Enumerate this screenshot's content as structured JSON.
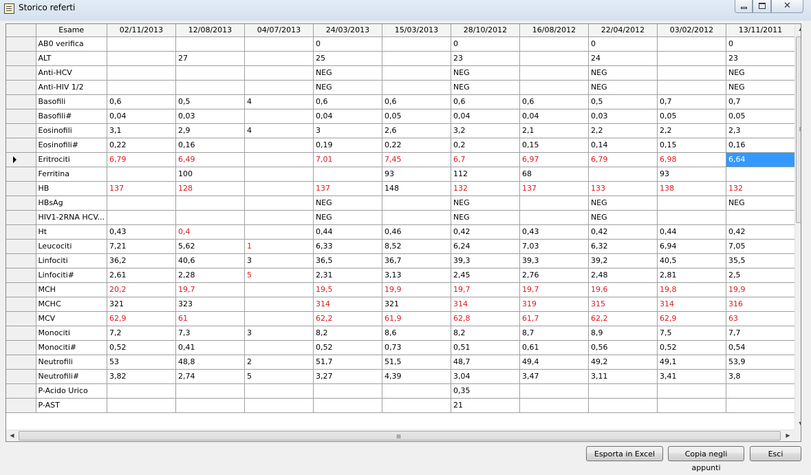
{
  "window": {
    "title": "Storico referti"
  },
  "grid": {
    "columns": [
      "Esame",
      "02/11/2013",
      "12/08/2013",
      "04/07/2013",
      "24/03/2013",
      "15/03/2013",
      "28/10/2012",
      "16/08/2012",
      "22/04/2012",
      "03/02/2012",
      "13/11/2011"
    ],
    "rows": [
      {
        "label": "AB0 verifica",
        "cells": [
          "",
          "",
          "",
          "0",
          "",
          "0",
          "",
          "0",
          "",
          "0"
        ]
      },
      {
        "label": "ALT",
        "cells": [
          "",
          "27",
          "",
          "25",
          "",
          "23",
          "",
          "24",
          "",
          "23"
        ]
      },
      {
        "label": "Anti-HCV",
        "cells": [
          "",
          "",
          "",
          "NEG",
          "",
          "NEG",
          "",
          "NEG",
          "",
          "NEG"
        ]
      },
      {
        "label": "Anti-HIV 1/2",
        "cells": [
          "",
          "",
          "",
          "NEG",
          "",
          "NEG",
          "",
          "NEG",
          "",
          "NEG"
        ]
      },
      {
        "label": "Basofili",
        "cells": [
          "0,6",
          "0,5",
          "4",
          "0,6",
          "0,6",
          "0,6",
          "0,6",
          "0,5",
          "0,7",
          "0,7"
        ]
      },
      {
        "label": "Basofili#",
        "cells": [
          "0,04",
          "0,03",
          "",
          "0,04",
          "0,05",
          "0,04",
          "0,04",
          "0,03",
          "0,05",
          "0,05"
        ]
      },
      {
        "label": "Eosinofili",
        "cells": [
          "3,1",
          "2,9",
          "4",
          "3",
          "2,6",
          "3,2",
          "2,1",
          "2,2",
          "2,2",
          "2,3"
        ]
      },
      {
        "label": "Eosinofili#",
        "cells": [
          "0,22",
          "0,16",
          "",
          "0,19",
          "0,22",
          "0,2",
          "0,15",
          "0,14",
          "0,15",
          "0,16"
        ]
      },
      {
        "label": "Eritrociti",
        "current": true,
        "cells": [
          "6,79",
          "6,49",
          "",
          "7,01",
          "7,45",
          "6,7",
          "6,97",
          "6,79",
          "6,98",
          "6,64"
        ],
        "red": [
          0,
          1,
          3,
          4,
          5,
          6,
          7,
          8
        ],
        "selected": 9
      },
      {
        "label": "Ferritina",
        "cells": [
          "",
          "100",
          "",
          "",
          "93",
          "112",
          "68",
          "",
          "93",
          ""
        ]
      },
      {
        "label": "HB",
        "cells": [
          "137",
          "128",
          "",
          "137",
          "148",
          "132",
          "137",
          "133",
          "138",
          "132"
        ],
        "red": [
          0,
          1,
          3,
          5,
          6,
          7,
          8,
          9
        ]
      },
      {
        "label": "HBsAg",
        "cells": [
          "",
          "",
          "",
          "NEG",
          "",
          "NEG",
          "",
          "NEG",
          "",
          "NEG"
        ]
      },
      {
        "label": "HIV1-2RNA HCV...",
        "cells": [
          "",
          "",
          "",
          "NEG",
          "",
          "NEG",
          "",
          "NEG",
          "",
          ""
        ]
      },
      {
        "label": "Ht",
        "cells": [
          "0,43",
          "0,4",
          "",
          "0,44",
          "0,46",
          "0,42",
          "0,43",
          "0,42",
          "0,44",
          "0,42"
        ],
        "red": [
          1
        ]
      },
      {
        "label": "Leucociti",
        "cells": [
          "7,21",
          "5,62",
          "1",
          "6,33",
          "8,52",
          "6,24",
          "7,03",
          "6,32",
          "6,94",
          "7,05"
        ],
        "red": [
          2
        ]
      },
      {
        "label": "Linfociti",
        "cells": [
          "36,2",
          "40,6",
          "3",
          "36,5",
          "36,7",
          "39,3",
          "39,3",
          "39,2",
          "40,5",
          "35,5"
        ]
      },
      {
        "label": "Linfociti#",
        "cells": [
          "2,61",
          "2,28",
          "5",
          "2,31",
          "3,13",
          "2,45",
          "2,76",
          "2,48",
          "2,81",
          "2,5"
        ],
        "red": [
          2
        ]
      },
      {
        "label": "MCH",
        "cells": [
          "20,2",
          "19,7",
          "",
          "19,5",
          "19,9",
          "19,7",
          "19,7",
          "19,6",
          "19,8",
          "19,9"
        ],
        "red": [
          0,
          1,
          3,
          4,
          5,
          6,
          7,
          8,
          9
        ]
      },
      {
        "label": "MCHC",
        "cells": [
          "321",
          "323",
          "",
          "314",
          "321",
          "314",
          "319",
          "315",
          "314",
          "316"
        ],
        "red": [
          3,
          5,
          6,
          7,
          8,
          9
        ]
      },
      {
        "label": "MCV",
        "cells": [
          "62,9",
          "61",
          "",
          "62,2",
          "61,9",
          "62,8",
          "61,7",
          "62,2",
          "62,9",
          "63"
        ],
        "red": [
          0,
          1,
          3,
          4,
          5,
          6,
          7,
          8,
          9
        ]
      },
      {
        "label": "Monociti",
        "cells": [
          "7,2",
          "7,3",
          "3",
          "8,2",
          "8,6",
          "8,2",
          "8,7",
          "8,9",
          "7,5",
          "7,7"
        ]
      },
      {
        "label": "Monociti#",
        "cells": [
          "0,52",
          "0,41",
          "",
          "0,52",
          "0,73",
          "0,51",
          "0,61",
          "0,56",
          "0,52",
          "0,54"
        ]
      },
      {
        "label": "Neutrofili",
        "cells": [
          "53",
          "48,8",
          "2",
          "51,7",
          "51,5",
          "48,7",
          "49,4",
          "49,2",
          "49,1",
          "53,9"
        ]
      },
      {
        "label": "Neutrofili#",
        "cells": [
          "3,82",
          "2,74",
          "5",
          "3,27",
          "4,39",
          "3,04",
          "3,47",
          "3,11",
          "3,41",
          "3,8"
        ]
      },
      {
        "label": "P-Acido Urico",
        "cells": [
          "",
          "",
          "",
          "",
          "",
          "0,35",
          "",
          "",
          "",
          ""
        ]
      },
      {
        "label": "P-AST",
        "cells": [
          "",
          "",
          "",
          "",
          "",
          "21",
          "",
          "",
          "",
          ""
        ]
      }
    ]
  },
  "buttons": {
    "export_excel": "Esporta in Excel",
    "copy_clipboard": "Copia negli appunti",
    "exit": "Esci"
  },
  "colors": {
    "abnormal": "#e0161b",
    "selection": "#3399ff"
  }
}
